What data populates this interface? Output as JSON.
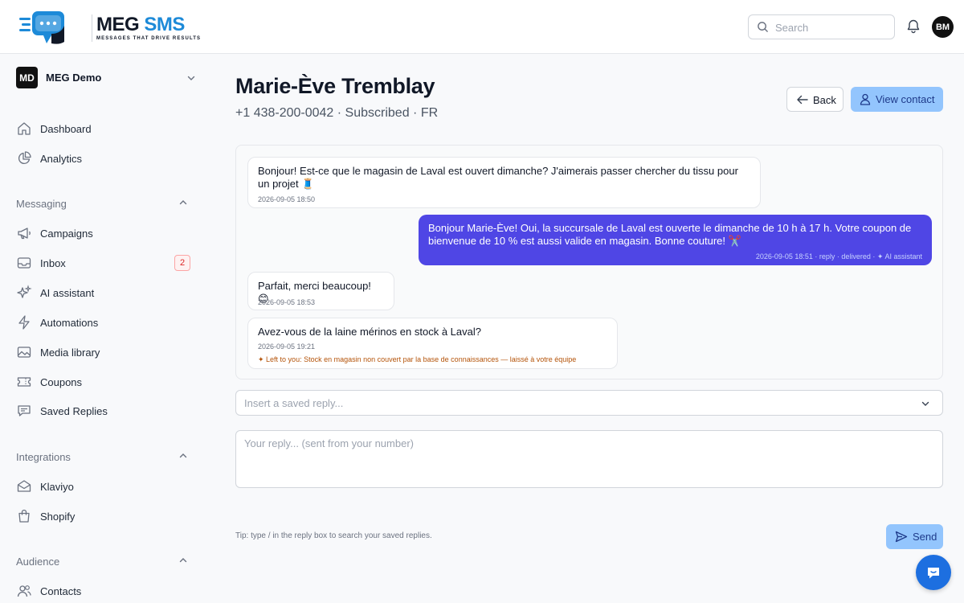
{
  "header": {
    "logo_name_part1": "MEG",
    "logo_name_part2": "SMS",
    "logo_tagline": "MESSAGES THAT DRIVE RESULTS",
    "search_placeholder": "Search",
    "avatar_initials": "BM",
    "brand_color": "#1d8ad8"
  },
  "sidebar": {
    "workspace": {
      "initials": "MD",
      "name": "MEG Demo"
    },
    "items_top": [
      {
        "label": "Dashboard",
        "icon": "home-icon"
      },
      {
        "label": "Analytics",
        "icon": "pie-chart-icon"
      }
    ],
    "sections": {
      "messaging": "Messaging",
      "integrations": "Integrations",
      "audience": "Audience"
    },
    "messaging_items": [
      {
        "label": "Campaigns",
        "icon": "megaphone-icon"
      },
      {
        "label": "Inbox",
        "icon": "inbox-icon",
        "badge": "2"
      },
      {
        "label": "AI assistant",
        "icon": "sparkles-icon"
      },
      {
        "label": "Automations",
        "icon": "lightning-icon"
      },
      {
        "label": "Media library",
        "icon": "image-icon"
      },
      {
        "label": "Coupons",
        "icon": "ticket-icon"
      },
      {
        "label": "Saved Replies",
        "icon": "chat-bubble-icon"
      }
    ],
    "integration_items": [
      {
        "label": "Klaviyo",
        "icon": "envelope-icon"
      },
      {
        "label": "Shopify",
        "icon": "shopping-bag-icon"
      }
    ],
    "audience_items": [
      {
        "label": "Contacts",
        "icon": "users-icon"
      }
    ]
  },
  "main": {
    "contact_name": "Marie-Ève Tremblay",
    "contact_info": "+1 438-200-0042 · Subscribed · FR",
    "back_label": "Back",
    "view_contact_label": "View contact",
    "messages": [
      {
        "direction": "inbound",
        "text": "Bonjour! Est-ce que le magasin de Laval est ouvert dimanche? J'aimerais passer chercher du tissu pour un projet 🧵",
        "meta": "2026-09-05 18:50"
      },
      {
        "direction": "outbound",
        "text": "Bonjour Marie-Ève! Oui, la succursale de Laval est ouverte le dimanche de 10 h à 17 h. Votre coupon de bienvenue de 10 % est aussi valide en magasin. Bonne couture! ✂️",
        "meta": "2026-09-05 18:51 · reply · delivered · ✦ AI assistant"
      },
      {
        "direction": "inbound",
        "text": "Parfait, merci beaucoup! 😊",
        "meta": "2026-09-05 18:53"
      },
      {
        "direction": "inbound",
        "text": "Avez-vous de la laine mérinos en stock à Laval?",
        "meta": "2026-09-05 19:21",
        "note": "✦ Left to you: Stock en magasin non couvert par la base de connaissances — laissé à votre équipe"
      }
    ],
    "saved_reply_placeholder": "Insert a saved reply...",
    "reply_placeholder": "Your reply... (sent from your number)",
    "tip": "Tip: type / in the reply box to search your saved replies.",
    "send_label": "Send"
  }
}
